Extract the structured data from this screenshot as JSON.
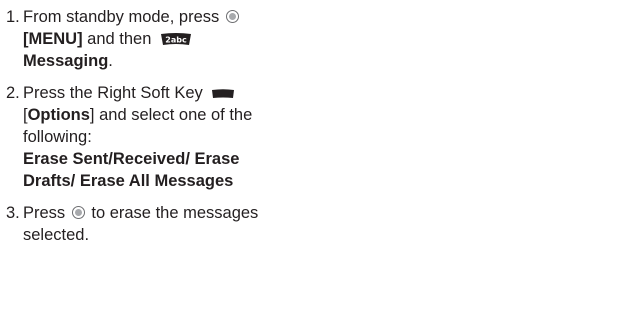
{
  "steps": [
    {
      "number": "1.",
      "line1": "From standby mode, press",
      "line2_menu": "[MENU]",
      "line2_text": " and then",
      "line3": "Messaging",
      "line3_end": "."
    },
    {
      "number": "2.",
      "line1": "Press the Right Soft Key",
      "line2_pre": "[",
      "line2_bold": "Options",
      "line2_post": "] and select one of the",
      "line3": "following:",
      "line4_bold": "Erase Sent/Received/ Erase",
      "line5_bold": "Drafts/ Erase All Messages"
    },
    {
      "number": "3.",
      "line1_pre": "Press",
      "line1_post": " to erase the messages",
      "line2": "selected."
    }
  ],
  "icons": {
    "ok_key": "ok-key-icon",
    "key_2": "key-2-abc-icon",
    "right_soft_key": "right-soft-key-icon"
  },
  "colors": {
    "text": "#231f20",
    "icon_gray": "#6d6e71",
    "icon_dark": "#231f20"
  }
}
